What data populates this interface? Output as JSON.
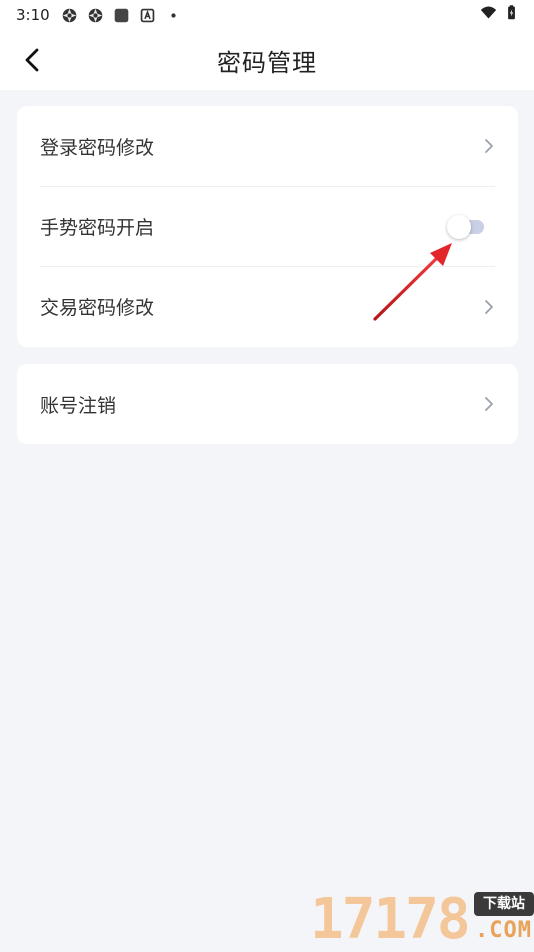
{
  "status_bar": {
    "time": "3:10",
    "left_icons": [
      "aperture-icon",
      "aperture-icon",
      "app-square-icon",
      "a-badge-icon",
      "dot-icon"
    ],
    "right_icons": [
      "wifi-icon",
      "battery-charging-icon"
    ]
  },
  "nav": {
    "title": "密码管理",
    "back_icon": "chevron-left-icon"
  },
  "group1": {
    "items": [
      {
        "label": "登录密码修改",
        "type": "link"
      },
      {
        "label": "手势密码开启",
        "type": "toggle",
        "enabled": false
      },
      {
        "label": "交易密码修改",
        "type": "link"
      }
    ]
  },
  "group2": {
    "items": [
      {
        "label": "账号注销",
        "type": "link"
      }
    ]
  },
  "annotation": {
    "color": "#E3262A",
    "target": "gesture-password-toggle"
  },
  "watermark": {
    "number": "17178",
    "badge": "下载站",
    "domain": ".COM"
  },
  "colors": {
    "background": "#F4F5F8",
    "card": "#FFFFFF",
    "toggle_off_track": "#C9CFE4",
    "divider": "#EEEFF2",
    "chevron": "#9AA0AC"
  }
}
